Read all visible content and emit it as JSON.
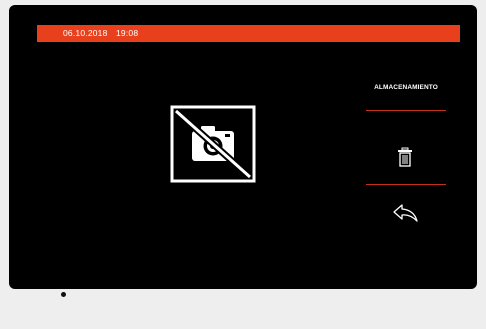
{
  "status_bar": {
    "date": "06.10.2018",
    "time": "19:08",
    "color": "#e8401d"
  },
  "preview": {
    "icon": "camera-off-icon"
  },
  "side_menu": {
    "storage_label": "ALMACENAMIENTO",
    "delete_icon": "trash-icon",
    "back_icon": "back-arrow-icon",
    "divider_color": "#c4301b"
  }
}
